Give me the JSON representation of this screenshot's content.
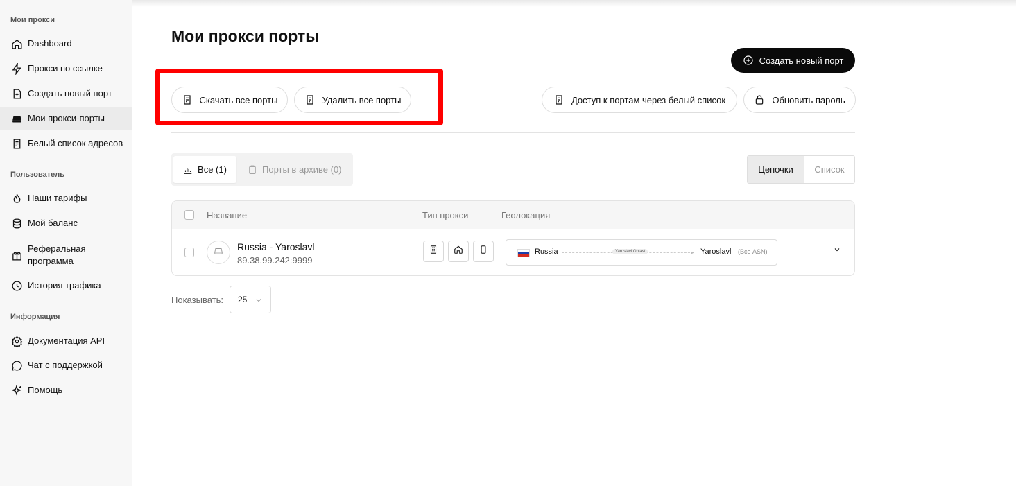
{
  "sidebar": {
    "sections": [
      "Мои прокси",
      "Пользователь",
      "Информация"
    ],
    "items": [
      {
        "label": "Dashboard",
        "icon": "home-icon"
      },
      {
        "label": "Прокси по ссылке",
        "icon": "lightning-icon"
      },
      {
        "label": "Создать новый порт",
        "icon": "file-plus-icon"
      },
      {
        "label": "Мои прокси-порты",
        "icon": "server-icon",
        "active": true
      },
      {
        "label": "Белый список адресов",
        "icon": "list-doc-icon"
      },
      {
        "label": "Наши тарифы",
        "icon": "fire-icon"
      },
      {
        "label": "Мой баланс",
        "icon": "database-icon"
      },
      {
        "label": "Реферальная программа",
        "icon": "gift-icon"
      },
      {
        "label": "История трафика",
        "icon": "clock-icon"
      },
      {
        "label": "Документация API",
        "icon": "gear-icon"
      },
      {
        "label": "Чат с поддержкой",
        "icon": "chat-icon"
      },
      {
        "label": "Помощь",
        "icon": "sparkle-icon"
      }
    ]
  },
  "page": {
    "title": "Мои прокси порты",
    "create_button": "Создать новый порт",
    "download_all": "Скачать все порты",
    "delete_all": "Удалить все порты",
    "whitelist_access": "Доступ к портам через белый список",
    "update_password": "Обновить пароль",
    "highlight_color": "#ff0000"
  },
  "tabs": {
    "all": "Все (1)",
    "archived": "Порты в архиве (0)"
  },
  "view_toggle": {
    "chains": "Цепочки",
    "list": "Список"
  },
  "table": {
    "headers": {
      "name": "Название",
      "proxy_type": "Тип прокси",
      "geo": "Геолокация"
    },
    "rows": [
      {
        "name": "Russia - Yaroslavl",
        "address": "89.38.99.242:9999",
        "types": [
          "building-icon",
          "house-icon",
          "phone-icon"
        ],
        "geo": {
          "country": "Russia",
          "region": "Yaroslavl Oblast",
          "city": "Yaroslavl",
          "asn": "(Все ASN)"
        }
      }
    ]
  },
  "pagination": {
    "show_label": "Показывать:",
    "per_page": "25"
  }
}
